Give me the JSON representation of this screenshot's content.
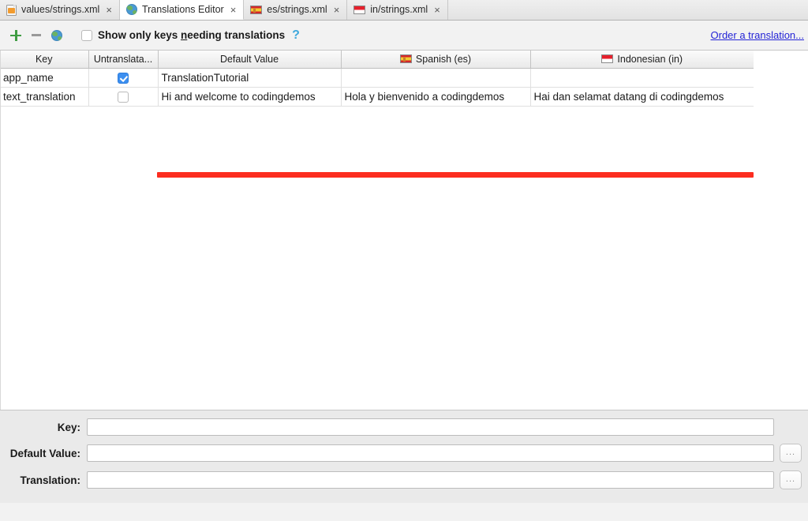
{
  "tabs": [
    {
      "label": "values/strings.xml",
      "icon": "xml-file-icon",
      "active": false,
      "close": "×"
    },
    {
      "label": "Translations Editor",
      "icon": "globe-icon",
      "active": true,
      "close": "×"
    },
    {
      "label": "es/strings.xml",
      "icon": "spain-flag-icon",
      "active": false,
      "close": "×"
    },
    {
      "label": "in/strings.xml",
      "icon": "indonesia-flag-icon",
      "active": false,
      "close": "×"
    }
  ],
  "toolbar": {
    "add_label": "+",
    "remove_label": "−",
    "locale_icon": "globe-icon",
    "filter_checkbox_checked": false,
    "filter_label_pre": "Show only keys ",
    "filter_label_mnemonic": "n",
    "filter_label_post": "eeding translations",
    "help_label": "?",
    "order_link": "Order a translation..."
  },
  "table": {
    "columns": [
      {
        "label": "Key",
        "icon": null
      },
      {
        "label": "Untranslata...",
        "icon": null
      },
      {
        "label": "Default Value",
        "icon": null
      },
      {
        "label": "Spanish (es)",
        "icon": "spain-flag-icon"
      },
      {
        "label": "Indonesian (in)",
        "icon": "indonesia-flag-icon"
      }
    ],
    "rows": [
      {
        "key": "app_name",
        "untranslatable": true,
        "default_value": "TranslationTutorial",
        "spanish": "",
        "indonesian": ""
      },
      {
        "key": "text_translation",
        "untranslatable": false,
        "default_value": "Hi and welcome to codingdemos",
        "spanish": "Hola y bienvenido a codingdemos",
        "indonesian": "Hai dan selamat datang di codingdemos"
      }
    ]
  },
  "annotation": {
    "shape": "red-underline-highlight",
    "color": "#fc2d20"
  },
  "form": {
    "key": {
      "label": "Key:",
      "value": "",
      "placeholder": ""
    },
    "default_value": {
      "label": "Default Value:",
      "value": "",
      "placeholder": "",
      "browse_label": "..."
    },
    "translation": {
      "label": "Translation:",
      "value": "",
      "placeholder": "",
      "browse_label": "..."
    }
  },
  "colors": {
    "accent_link": "#2424d6",
    "add_green": "#3f9c43",
    "checkbox_blue": "#3c8ff0",
    "annotation_red": "#fc2d20",
    "help_blue": "#3fa9dd"
  }
}
